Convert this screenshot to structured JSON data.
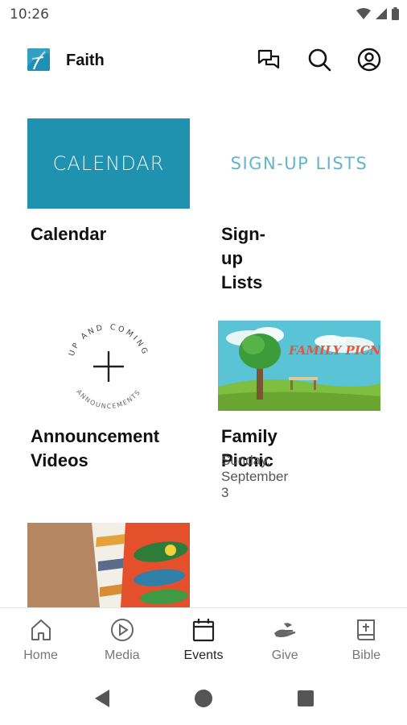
{
  "status_bar": {
    "time": "10:26",
    "icons": [
      "wifi-icon",
      "signal-icon",
      "battery-icon"
    ]
  },
  "header": {
    "app_name": "Faith",
    "icons": [
      "chat-icon",
      "search-icon",
      "account-icon"
    ]
  },
  "colors": {
    "accent": "#1e92ae",
    "signup_text": "#62b6cc",
    "text": "#111111",
    "muted": "#777777"
  },
  "tiles": [
    {
      "thumb_text": "CALENDAR",
      "title": "Calendar"
    },
    {
      "thumb_text": "SIGN-UP LISTS",
      "title": "Sign-up Lists"
    },
    {
      "thumb_arc_top": "UP AND COMING",
      "thumb_arc_bottom": "ANNOUNCEMENTS",
      "title_line1": "Announcement",
      "title_line2": "Videos"
    },
    {
      "thumb_title": "FAMILY PICNIC!",
      "title": "Family Picnic",
      "subtitle": "Sunday, September 3"
    },
    {
      "thumb": "vbs-photo"
    }
  ],
  "bottom_nav": [
    {
      "label": "Home",
      "icon": "home-icon"
    },
    {
      "label": "Media",
      "icon": "play-icon"
    },
    {
      "label": "Events",
      "icon": "calendar-icon",
      "active": true
    },
    {
      "label": "Give",
      "icon": "give-icon"
    },
    {
      "label": "Bible",
      "icon": "bible-icon"
    }
  ],
  "system_nav": [
    "back-button",
    "home-button",
    "recents-button"
  ]
}
